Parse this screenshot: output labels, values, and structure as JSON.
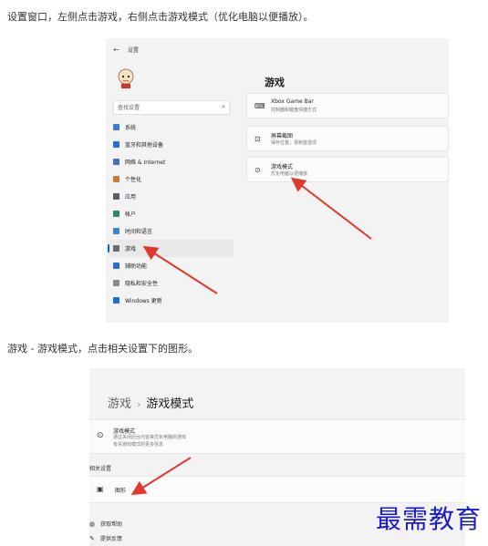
{
  "captions": {
    "intro": "设置窗口，左侧点击游戏，右侧点击游戏模式（优化电脑以便播放）。",
    "second": "游戏 - 游戏模式，点击相关设置下的图形。"
  },
  "screen1": {
    "back_icon": "back-arrow-icon",
    "window_title": "设置",
    "search_placeholder": "查找设置",
    "nav": [
      {
        "label": "系统",
        "color": "#3a7bd5"
      },
      {
        "label": "蓝牙和其他设备",
        "color": "#2a6fd6"
      },
      {
        "label": "网络 & Internet",
        "color": "#4a6fb5"
      },
      {
        "label": "个性化",
        "color": "#c87a3a"
      },
      {
        "label": "应用",
        "color": "#555c6b"
      },
      {
        "label": "帐户",
        "color": "#2b8a6e"
      },
      {
        "label": "时间和语言",
        "color": "#3b86d0"
      },
      {
        "label": "游戏",
        "color": "#6a6a6a"
      },
      {
        "label": "辅助功能",
        "color": "#2c6fcf"
      },
      {
        "label": "隐私和安全性",
        "color": "#8a8a8a"
      },
      {
        "label": "Windows 更新",
        "color": "#1f6fd0"
      }
    ],
    "active_index": 7,
    "main_title": "游戏",
    "cards": [
      {
        "icon": "xbox-game-bar-icon",
        "title": "Xbox Game Bar",
        "subtitle": "控制器和键盘快捷方式"
      },
      {
        "icon": "capture-icon",
        "title": "屏幕截图",
        "subtitle": "保存位置，录制首选项"
      },
      {
        "icon": "game-mode-icon",
        "title": "游戏模式",
        "subtitle": "优化电脑以便播放"
      }
    ]
  },
  "screen2": {
    "breadcrumb_parent": "游戏",
    "breadcrumb_sep": "›",
    "breadcrumb_current": "游戏模式",
    "game_mode_title": "游戏模式",
    "game_mode_desc1": "通过关闭后台内容来优化电脑的游戏",
    "game_mode_desc2": "有关游戏模式的更多信息",
    "related_heading": "相关设置",
    "graphics_label": "图形",
    "help_get": "获取帮助",
    "help_feedback": "提供反馈"
  },
  "watermark": "最需教育",
  "annotation_color": "#e03a2c"
}
